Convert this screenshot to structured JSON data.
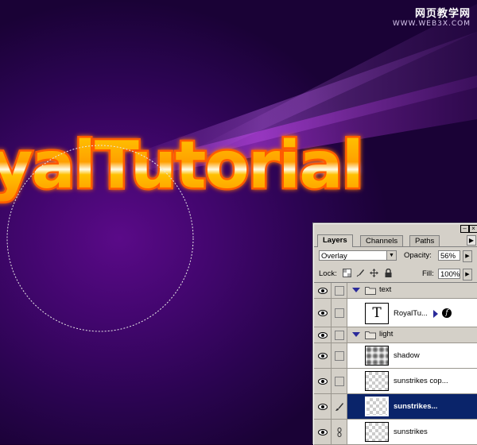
{
  "artwork": {
    "title_text": "yalTutorial",
    "colors": {
      "glow": "#ffb000",
      "outline": "#ff7a00",
      "highlight": "#fffbe6",
      "ray": "#c050e0"
    }
  },
  "watermark": {
    "site_name": "网页教学网",
    "url": "WWW.WEB3X.COM"
  },
  "layers_panel": {
    "tabs": [
      {
        "label": "Layers",
        "active": true
      },
      {
        "label": "Channels",
        "active": false
      },
      {
        "label": "Paths",
        "active": false
      }
    ],
    "blend_mode": "Overlay",
    "opacity_label": "Opacity:",
    "opacity_value": "56%",
    "lock_label": "Lock:",
    "fill_label": "Fill:",
    "fill_value": "100%",
    "layers": [
      {
        "type": "group",
        "name": "text",
        "expanded": true
      },
      {
        "type": "text",
        "name": "RoyalTu...",
        "thumb_glyph": "T",
        "has_effects": true,
        "fx_glyph": "f"
      },
      {
        "type": "group",
        "name": "light",
        "expanded": true
      },
      {
        "type": "layer",
        "name": "shadow",
        "thumb": "shadow"
      },
      {
        "type": "layer",
        "name": "sunstrikes cop...",
        "thumb": "transparent"
      },
      {
        "type": "layer",
        "name": "sunstrikes...",
        "thumb": "transparent",
        "selected": true
      },
      {
        "type": "layer",
        "name": "sunstrikes",
        "thumb": "transparent"
      }
    ],
    "selection_color": "#0a246a"
  }
}
